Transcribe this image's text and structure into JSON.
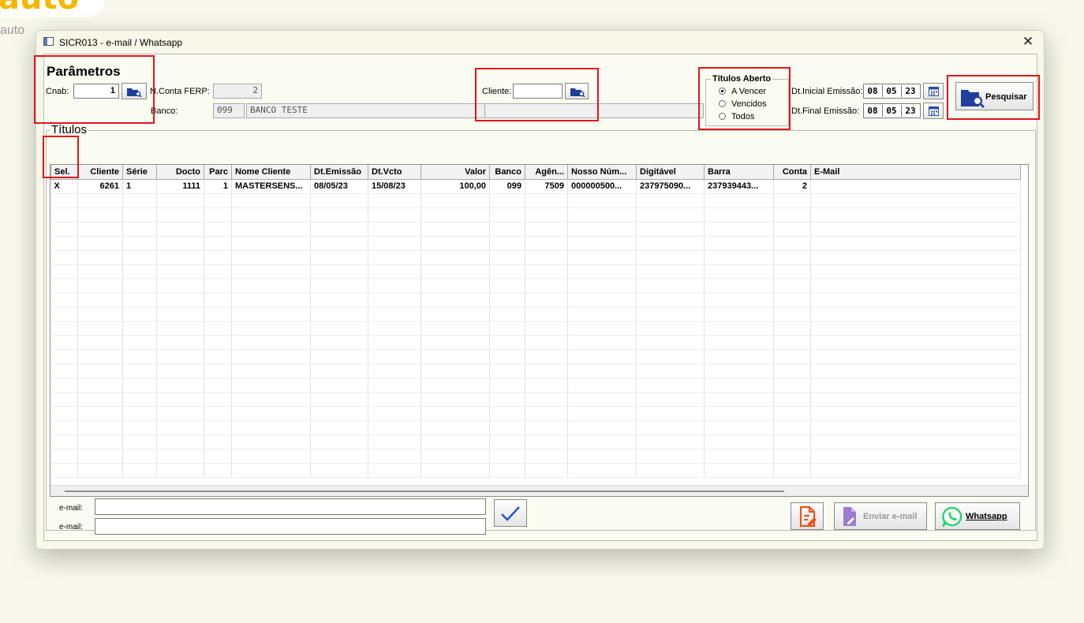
{
  "background": {
    "logo": "auto",
    "subtitle": "auto"
  },
  "window": {
    "title": "SICR013 - e-mail / Whatsapp",
    "close": "✕"
  },
  "parametros": {
    "title": "Parâmetros",
    "cnab_label": "Cnab:",
    "cnab_value": "1",
    "nconta_label": "N.Conta FERP:",
    "nconta_value": "2",
    "banco_label": "Banco:",
    "banco_code": "099",
    "banco_name": "BANCO TESTE",
    "cliente_label": "Cliente:",
    "cliente_value": "",
    "cliente_name": ""
  },
  "titulos_aberto": {
    "title": "Títulos Aberto",
    "options": [
      {
        "label": "A Vencer",
        "selected": true
      },
      {
        "label": "Vencidos",
        "selected": false
      },
      {
        "label": "Todos",
        "selected": false
      }
    ]
  },
  "dates": {
    "inicial_label": "Dt.Inicial Emissão:",
    "inicial": {
      "d": "08",
      "m": "05",
      "y": "23"
    },
    "final_label": "Dt.Final Emissão:",
    "final": {
      "d": "08",
      "m": "05",
      "y": "23"
    }
  },
  "pesquisar_label": "Pesquisar",
  "titulos": {
    "title": "Títulos",
    "columns": [
      "Sel.",
      "Cliente",
      "Série",
      "Docto",
      "Parc",
      "Nome Cliente",
      "Dt.Emissão",
      "Dt.Vcto",
      "Valor",
      "Banco",
      "Agên...",
      "Nosso Núm...",
      "Digitável",
      "Barra",
      "Conta",
      "E-Mail"
    ],
    "rows": [
      [
        "X",
        "6261",
        "1",
        "1111",
        "1",
        "MASTERSENS...",
        "08/05/23",
        "15/08/23",
        "100,00",
        "099",
        "7509",
        "000000500...",
        "237975090...",
        "237939443...",
        "2",
        ""
      ]
    ]
  },
  "footer": {
    "email1_label": "e-mail:",
    "email1_value": "",
    "email2_label": "e-mail:",
    "email2_value": "",
    "enviar_label": "Enviar e-mail",
    "whatsapp_label": "Whatsapp"
  },
  "colors": {
    "highlight": "#e0161e",
    "accent": "#1f3f9c",
    "whatsapp": "#25d366",
    "pdf": "#e8541c",
    "disabled": "#9c7bd4"
  },
  "icons": [
    "search-folder-icon",
    "calendar-icon",
    "checkmark-icon",
    "document-edit-icon",
    "whatsapp-icon"
  ]
}
